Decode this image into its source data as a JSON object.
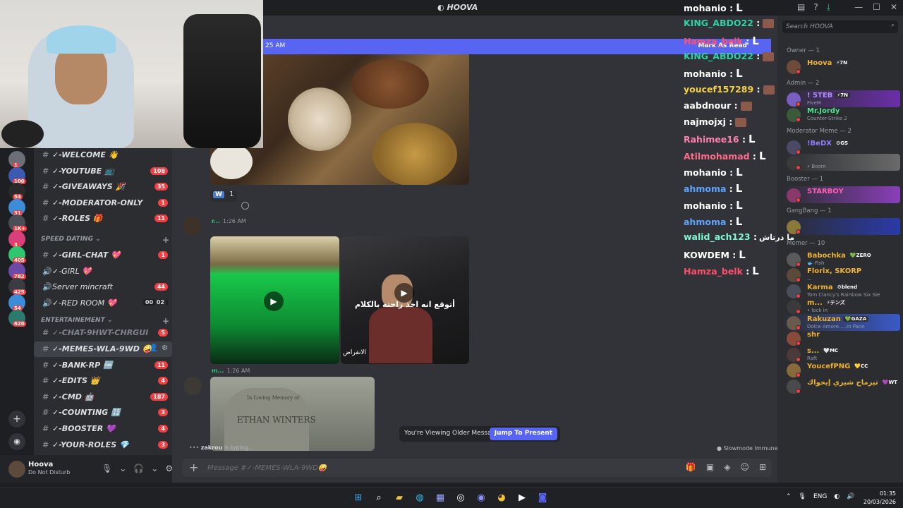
{
  "window": {
    "title": "HOOVA",
    "controls": [
      "—",
      "☐",
      "✕"
    ]
  },
  "banner": {
    "time": "25 AM",
    "mark_read": "Mark As Read"
  },
  "sidebar": {
    "channels_top": [
      {
        "name": "✓-WELCOME 👋",
        "count": ""
      },
      {
        "name": "✓-YOUTUBE 📺",
        "count": "108"
      },
      {
        "name": "✓-GIVEAWAYS 🎉",
        "count": "35"
      },
      {
        "name": "✓-MODERATOR-ONLY",
        "count": "1"
      },
      {
        "name": "✓-ROLES 🎁",
        "count": "11"
      }
    ],
    "cat_speed": "SPEED DATING",
    "channels_speed": [
      {
        "name": "✓-GIRL-CHAT 💖",
        "count": "1",
        "type": "text"
      },
      {
        "name": "✓-GIRL 💖",
        "count": "",
        "type": "voice"
      },
      {
        "name": "Server mincraft",
        "count": "44",
        "type": "voice"
      },
      {
        "name": "✓-RED ROOM 💖",
        "count": "",
        "type": "voice",
        "users": "00",
        "limit": "02"
      }
    ],
    "cat_ent": "ENTERTAINEMENT",
    "channels_ent": [
      {
        "name": "✓-CHAT-9HWT-CHRGUI",
        "count": "5",
        "muted": true
      },
      {
        "name": "✓-MEMES-WLA-9WD 🤪",
        "count": "",
        "active": true
      },
      {
        "name": "✓-BANK-RP 🆒",
        "count": "11"
      },
      {
        "name": "✓-EDITS 👑",
        "count": "4"
      },
      {
        "name": "✓-CMD 🤖",
        "count": "187"
      },
      {
        "name": "✓-COUNTING 🔢",
        "count": "3"
      },
      {
        "name": "✓-BOOSTER 💜",
        "count": "4"
      },
      {
        "name": "✓-YOUR-ROLES 💎",
        "count": "3"
      }
    ]
  },
  "rail_badges": [
    "1",
    "100",
    "54",
    "31",
    "1K+",
    "3",
    "405",
    "782",
    "425",
    "54",
    "620"
  ],
  "user": {
    "name": "Hoova",
    "status": "Do Not Disturb"
  },
  "messages": {
    "topic_channel": "WD🤪",
    "reaction_count": "1",
    "reaction_letter": "W",
    "msg1_author": "r...",
    "msg1_time": "1:26 AM",
    "msg2_author": "m...",
    "msg2_time": "1:26 AM",
    "video_caption": "أتوقع انه اخذ راحته بالكلام",
    "video_tag": "الانقراض",
    "tomb_line1": "In Loving Memory of",
    "tomb_line2": "ETHAN WINTERS"
  },
  "older_bar": {
    "text": "You're Viewing Older Messages",
    "button": "Jump To Present"
  },
  "typing": {
    "user": "zakrou",
    "suffix": "is typing..."
  },
  "slowmode": "Slowmode Immune",
  "composer": {
    "placeholder": "Message #✓-MEMES-WLA-9WD🤪"
  },
  "stream_chat": [
    {
      "user": "mohanio",
      "color": "#ffffff",
      "msg": "L"
    },
    {
      "user": "KING_ABDO22",
      "color": "#2fd2a6",
      "msg": "",
      "emote": true
    },
    {
      "user": "Hamza_belk",
      "color": "#ff4f6d",
      "msg": "L"
    },
    {
      "user": "KING_ABDO22",
      "color": "#2fd2a6",
      "msg": "",
      "emote": true
    },
    {
      "user": "mohanio",
      "color": "#ffffff",
      "msg": "L"
    },
    {
      "user": "youcef157289",
      "color": "#f5d142",
      "msg": "",
      "emote": true
    },
    {
      "user": "aabdnour",
      "color": "#ffffff",
      "msg": "",
      "emote": true
    },
    {
      "user": "najmojxj",
      "color": "#ffffff",
      "msg": "",
      "emote": true
    },
    {
      "user": "Rahimee16",
      "color": "#ff7fb2",
      "msg": "L"
    },
    {
      "user": "Atilmohamad",
      "color": "#ff6b8a",
      "msg": "L"
    },
    {
      "user": "mohanio",
      "color": "#ffffff",
      "msg": "L"
    },
    {
      "user": "ahmoma",
      "color": "#5ea3ff",
      "msg": "L"
    },
    {
      "user": "mohanio",
      "color": "#ffffff",
      "msg": "L"
    },
    {
      "user": "ahmoma",
      "color": "#5ea3ff",
      "msg": "L"
    },
    {
      "user": "walid_ach123",
      "color": "#7ff7d0",
      "msg": "",
      "arabic": "ما درتاش"
    },
    {
      "user": "KOWDEM",
      "color": "#ffffff",
      "msg": "L"
    },
    {
      "user": "Hamza_belk",
      "color": "#ff4f6d",
      "msg": "L"
    }
  ],
  "members": {
    "search_placeholder": "Search HOOVA",
    "groups": [
      {
        "title": "Owner — 1",
        "items": [
          {
            "name": "Hoova",
            "tag": "⚡7N",
            "status": "",
            "color": "#f0b232"
          }
        ]
      },
      {
        "title": "Admin — 2",
        "items": [
          {
            "name": "! 5TEB",
            "tag": "⚡7N",
            "status": "FiveM",
            "color": "#b38cff"
          },
          {
            "name": "Mr.Jordy",
            "tag": "",
            "status": "Counter-Strike 2",
            "color": "#4fe38a"
          }
        ]
      },
      {
        "title": "Moderator Meme — 2",
        "items": [
          {
            "name": "!BeDX",
            "tag": "⚙GS",
            "status": "",
            "color": "#8f7dff"
          },
          {
            "name": "",
            "tag": "",
            "status": "• Boom",
            "color": "#4fe38a"
          }
        ]
      },
      {
        "title": "Booster — 1",
        "items": [
          {
            "name": "STARBOY",
            "tag": "",
            "status": "",
            "color": "#ff5fb0"
          }
        ]
      },
      {
        "title": "GangBang — 1",
        "items": [
          {
            "name": "",
            "tag": "",
            "status": "",
            "color": "#ffd25f"
          }
        ]
      },
      {
        "title": "Memer — 10",
        "items": [
          {
            "name": "Babochka",
            "tag": "💚ZERO",
            "status": "🐟 Fish",
            "color": "#f0b232"
          },
          {
            "name": "Florix, SKORP",
            "tag": "",
            "status": "...",
            "color": "#f0b232"
          },
          {
            "name": "Karma",
            "tag": "⚙blend",
            "status": "Tom Clancy's Rainbow Six Sie",
            "color": "#f0b232"
          },
          {
            "name": "m...",
            "tag": "⚡テンズ",
            "status": "• lock in",
            "color": "#f0b232"
          },
          {
            "name": "Rakuzan",
            "tag": "💚GAZA",
            "status": "Dolce Amore.....In Pace",
            "color": "#f0b232"
          },
          {
            "name": "shr",
            "tag": "",
            "status": "",
            "color": "#f0b232"
          },
          {
            "name": "s...",
            "tag": "🤍MC",
            "status": "Raft",
            "color": "#f0b232"
          },
          {
            "name": "YoucefPNG",
            "tag": "💛CC",
            "status": "",
            "color": "#f0b232"
          },
          {
            "name": "تيرماح شيزي إيحواك",
            "tag": "💜WT",
            "status": "",
            "color": "#f0b232"
          }
        ]
      }
    ]
  },
  "taskbar": {
    "lang": "ENG",
    "time": "01:35",
    "date": "20/03/2026"
  }
}
